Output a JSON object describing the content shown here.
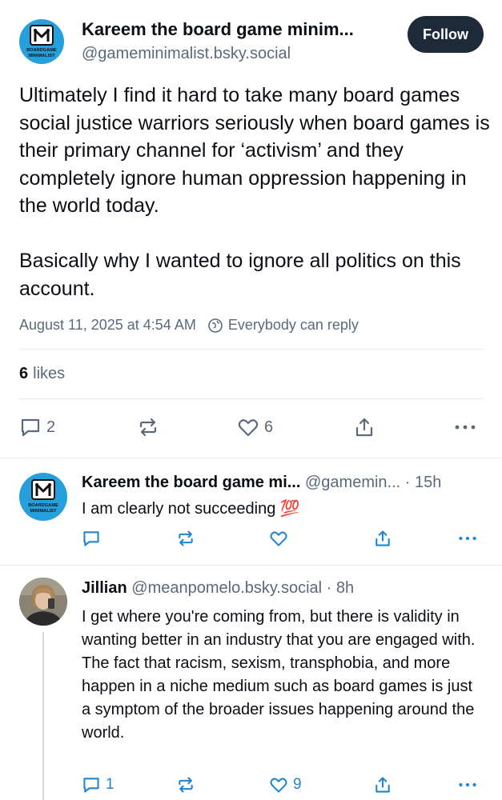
{
  "main_post": {
    "author_name": "Kareem the board game minim...",
    "author_handle": "@gameminimalist.bsky.social",
    "avatar_text": "BOARDGAME MINIMALIST",
    "follow_label": "Follow",
    "paragraphs": [
      "Ultimately I find it hard to take many board games social justice warriors seriously when board games is their primary channel for ‘activism’ and they completely ignore human oppression happening in the world today.",
      "Basically why I wanted to ignore all politics on this account."
    ],
    "timestamp": "August 11, 2025 at 4:54 AM",
    "reply_setting": "Everybody can reply",
    "likes_count": "6",
    "likes_label": "likes",
    "replies_count": "2",
    "like_count": "6"
  },
  "replies": [
    {
      "author_name": "Kareem the board game mi...",
      "author_handle": "@gamemin...",
      "time": "· 15h",
      "avatar_text": "BOARDGAME MINIMALIST",
      "text": "I am clearly not succeeding 💯"
    },
    {
      "author_name": "Jillian",
      "author_handle": "@meanpomelo.bsky.social",
      "time": "· 8h",
      "text": "I get where you're coming from, but there is validity in wanting better in an industry that you are engaged with. The fact that racism, sexism, transphobia, and more happen in a niche medium such as board games is just a symptom of the broader issues happening around the world.",
      "reply_count": "1",
      "like_count": "9"
    }
  ],
  "colors": {
    "accent_dark": "#1e2a3a",
    "muted_text": "#5a6a7b",
    "avatar_blue": "#25a0dc",
    "hundred_emoji": "#e0262b"
  },
  "icons": [
    "reply-icon",
    "repost-icon",
    "like-icon",
    "share-icon",
    "more-icon",
    "globe-icon"
  ]
}
